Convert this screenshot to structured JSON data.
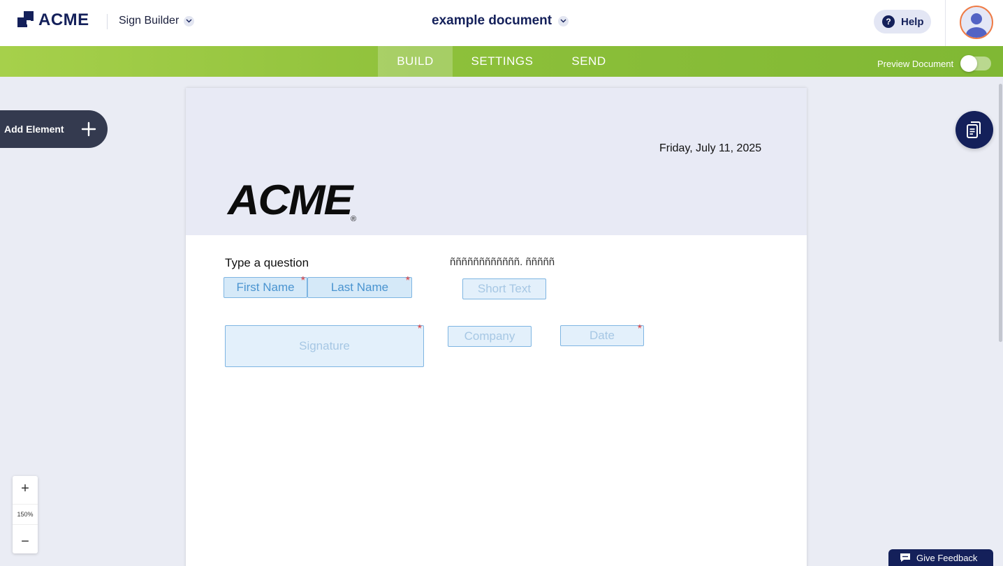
{
  "header": {
    "logo_text": "ACME",
    "app_name": "Sign Builder",
    "document_title": "example document",
    "help_label": "Help"
  },
  "nav": {
    "tabs": [
      {
        "label": "BUILD",
        "active": true
      },
      {
        "label": "SETTINGS",
        "active": false
      },
      {
        "label": "SEND",
        "active": false
      }
    ],
    "preview_label": "Preview Document",
    "preview_enabled": false
  },
  "sidebar": {
    "add_element_label": "Add Element"
  },
  "document": {
    "date": "Friday, July 11, 2025",
    "header_logo": "ACME",
    "header_logo_mark": "®",
    "question_label": "Type a question",
    "garbled_text": "ññññññññññññ. ñññññ",
    "fields": {
      "first_name": "First Name",
      "last_name": "Last Name",
      "short_text": "Short Text",
      "signature": "Signature",
      "company": "Company",
      "date": "Date"
    }
  },
  "zoom": {
    "plus": "+",
    "level": "150%",
    "minus": "−"
  },
  "feedback_label": "Give Feedback",
  "colors": {
    "brand_navy": "#14205a",
    "nav_green": "#8dc03a",
    "field_border": "#7eb5e2",
    "required_star": "#e03a3a",
    "avatar_ring": "#ef7b45"
  }
}
